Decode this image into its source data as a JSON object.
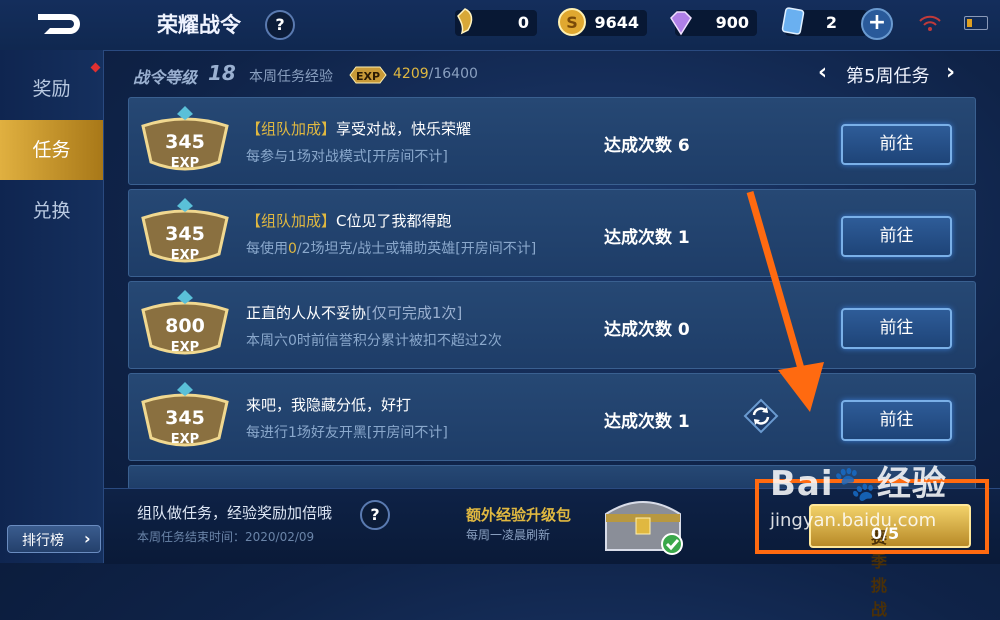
{
  "header": {
    "title": "荣耀战令",
    "help": "?",
    "currencies": [
      {
        "icon": "token-icon",
        "amount": "0"
      },
      {
        "icon": "gold-coin-icon",
        "amount": "9644"
      },
      {
        "icon": "diamond-icon",
        "amount": "900"
      },
      {
        "icon": "voucher-card-icon",
        "amount": "2"
      }
    ],
    "plus": "+"
  },
  "sidebar": {
    "items": [
      {
        "label": "奖励",
        "active": false
      },
      {
        "label": "任务",
        "active": true
      },
      {
        "label": "兑换",
        "active": false
      }
    ],
    "rank_label": "排行榜"
  },
  "summary": {
    "level_label": "战令等级",
    "level": "18",
    "week_exp_label": "本周任务经验",
    "exp_badge": "EXP",
    "exp_current": "4209",
    "exp_max": "/16400",
    "week_label": "第5周任务"
  },
  "tasks": [
    {
      "exp": "345",
      "tag": "【组队加成】",
      "title": "享受对战，快乐荣耀",
      "note": "",
      "desc_pre": "每参与1场对战模式[开房间不计]",
      "desc_hl": "",
      "desc_post": "",
      "count": "达成次数 6",
      "button": "前往"
    },
    {
      "exp": "345",
      "tag": "【组队加成】",
      "title": "C位见了我都得跑",
      "note": "",
      "desc_pre": "每使用",
      "desc_hl": "0",
      "desc_post": "/2场坦克/战士或辅助英雄[开房间不计]",
      "count": "达成次数 1",
      "button": "前往"
    },
    {
      "exp": "800",
      "tag": "",
      "title": "正直的人从不妥协",
      "note": "[仅可完成1次]",
      "desc_pre": "本周六0时前信誉积分累计被扣不超过2次",
      "desc_hl": "",
      "desc_post": "",
      "count": "达成次数 0",
      "button": "前往"
    },
    {
      "exp": "345",
      "tag": "",
      "title": "来吧，我隐藏分低，好打",
      "note": "",
      "desc_pre": "每进行1场好友开黑[开房间不计]",
      "desc_hl": "",
      "desc_post": "",
      "count": "达成次数 1",
      "button": "前往"
    }
  ],
  "medal_exp_label": "EXP",
  "bottom": {
    "tip": "组队做任务，经验奖励加倍哦",
    "end_time": "本周任务结束时间：2020/02/09",
    "pack_title": "额外经验升级包",
    "pack_sub": "每周一凌晨刷新",
    "season_label": "赛季挑战",
    "season_progress": "0/5"
  },
  "watermark": {
    "brand": "Bai",
    "brand2": "经验",
    "url": "jingyan.baidu.com"
  },
  "colors": {
    "accent_gold": "#e0b840",
    "highlight_orange": "#ff6a10"
  }
}
